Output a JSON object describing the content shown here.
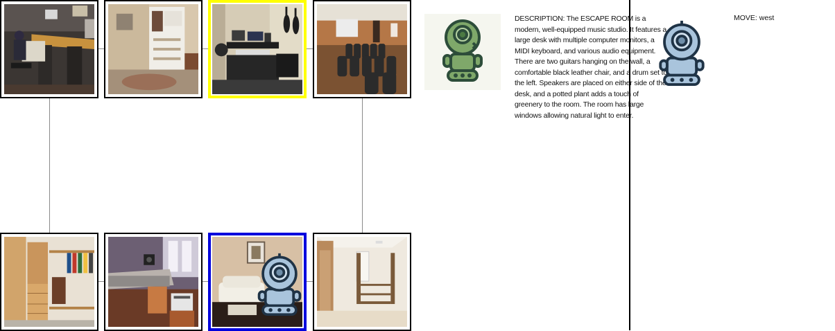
{
  "panel": {
    "description": "DESCRIPTION: The ESCAPE ROOM is a modern, well-equipped music studio. It features a large desk with multiple computer monitors, a MIDI keyboard, and various audio equipment. There are two guitars hanging on the wall, a comfortable black leather chair, and a drum set to the left. Speakers are placed on either side of the desk, and a potted plant adds a touch of greenery to the room. The room has large windows allowing natural light to enter.",
    "move": "MOVE: west"
  },
  "board": {
    "rooms_top": [
      {
        "scene": "music-studio-engineer"
      },
      {
        "scene": "walk-in-closet"
      },
      {
        "scene": "music-studio-guitars",
        "state": "current"
      },
      {
        "scene": "home-theater"
      }
    ],
    "rooms_bottom": [
      {
        "scene": "wardrobe-closet"
      },
      {
        "scene": "recording-studio-console"
      },
      {
        "scene": "living-room",
        "state": "player"
      },
      {
        "scene": "empty-closet"
      }
    ]
  },
  "colors": {
    "current_highlight": "#ffff00",
    "player_highlight": "#0000dd",
    "connector": "#8a8a8a",
    "robot_green": "#7fa86a",
    "robot_blue": "#a9c4dc"
  },
  "icons": {
    "guide_avatar": "green-robot-icon",
    "agent_avatar": "blue-robot-icon"
  }
}
